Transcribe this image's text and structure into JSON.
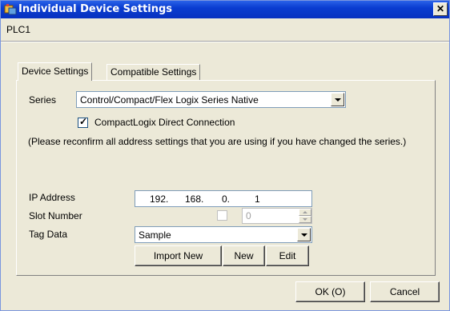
{
  "window": {
    "title": "Individual Device Settings",
    "close_label": "✕"
  },
  "device_name": "PLC1",
  "tabs": [
    {
      "label": "Device Settings",
      "active": true
    },
    {
      "label": "Compatible Settings",
      "active": false
    }
  ],
  "series": {
    "label": "Series",
    "value": "Control/Compact/Flex Logix Series Native"
  },
  "direct_connection": {
    "label": "CompactLogix Direct Connection",
    "checked": true
  },
  "notice": "(Please reconfirm all address settings that you are using if you have changed the series.)",
  "ip_address": {
    "label": "IP Address",
    "octets": [
      "192.",
      "168.",
      "0.",
      "1"
    ]
  },
  "slot_number": {
    "label": "Slot Number",
    "enabled": false,
    "value": "0"
  },
  "tag_data": {
    "label": "Tag Data",
    "value": "Sample"
  },
  "tag_buttons": {
    "import_new": "Import New",
    "new": "New",
    "edit": "Edit"
  },
  "footer": {
    "ok": "OK (O)",
    "cancel": "Cancel"
  },
  "colors": {
    "titlebar": "#0a3dd0",
    "dialog_bg": "#ece9d8",
    "field_border": "#7f9db9"
  }
}
